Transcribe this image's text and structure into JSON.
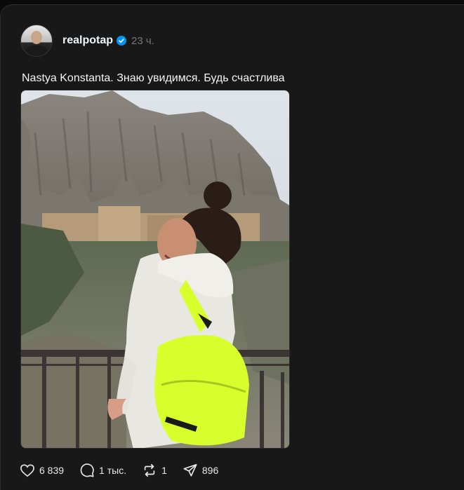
{
  "post": {
    "username": "realpotap",
    "time": "23 ч.",
    "caption": "Nastya Konstanta. Знаю увидимся. Будь счастлива"
  },
  "actions": {
    "likes": "6 839",
    "replies": "1 тыс.",
    "reposts": "1",
    "shares": "896"
  },
  "colors": {
    "background": "#181818",
    "verified": "#0095f6"
  }
}
